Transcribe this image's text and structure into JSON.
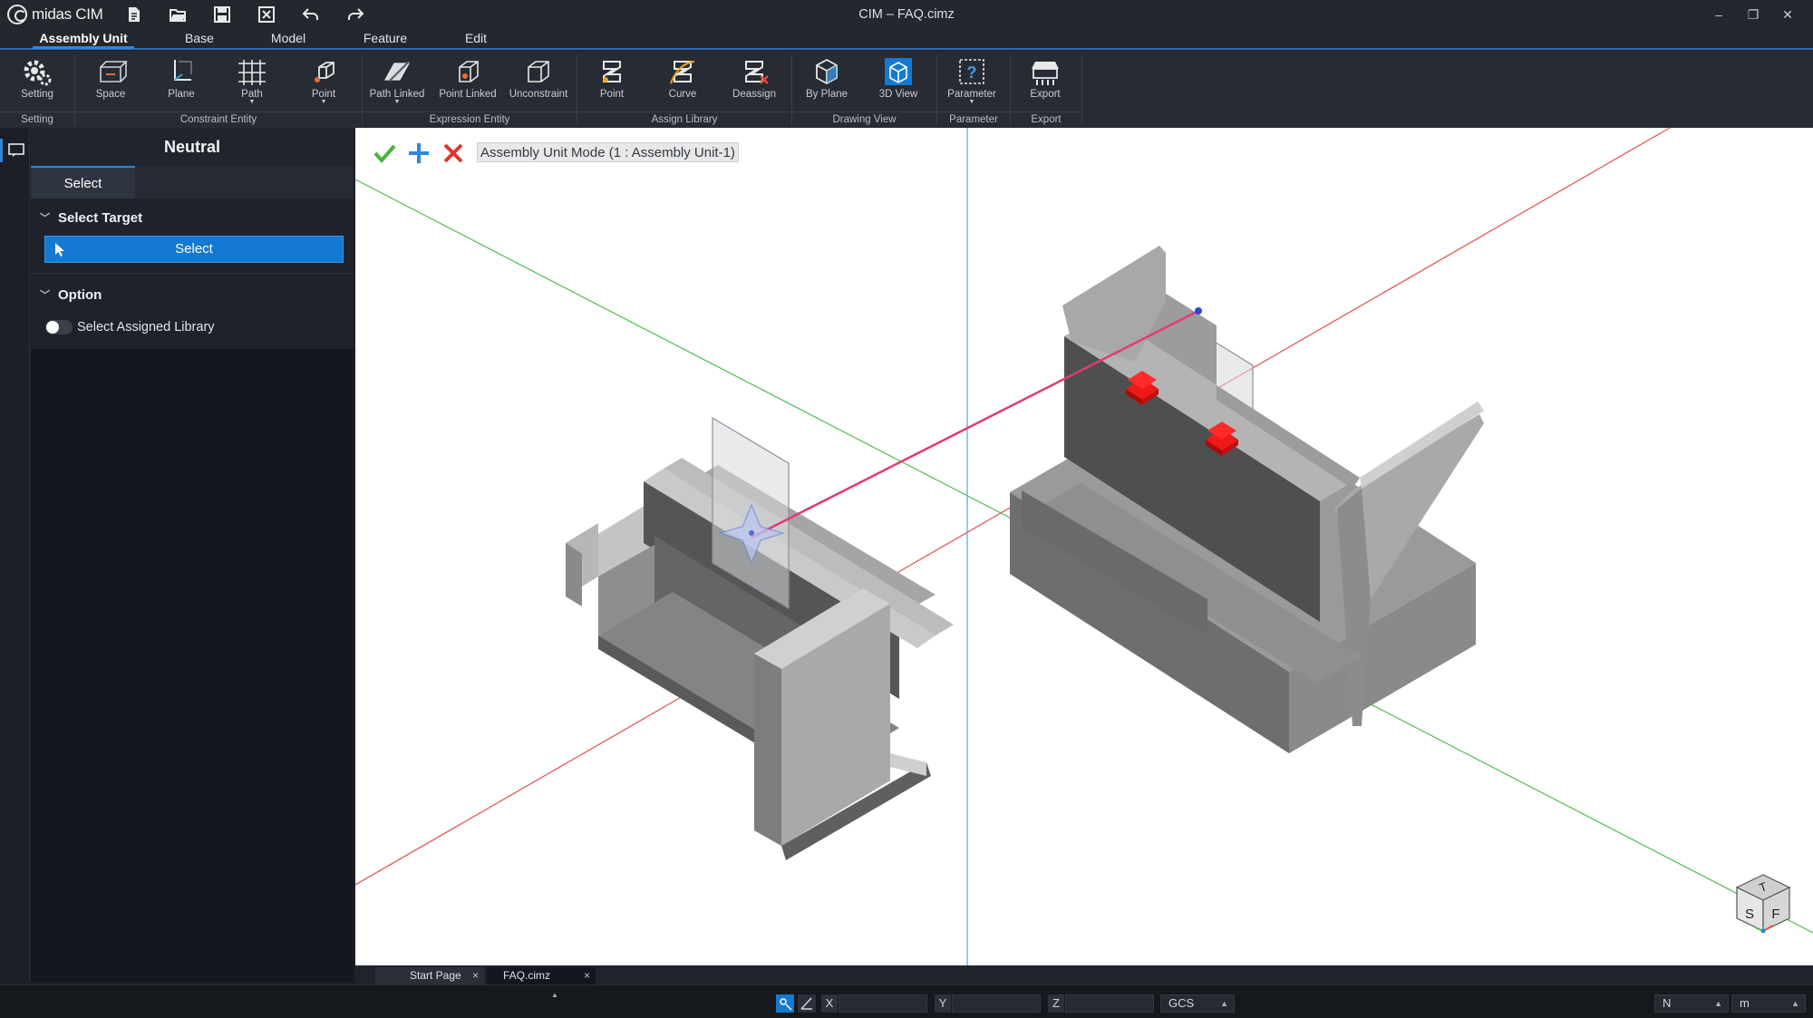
{
  "app": {
    "name": "midas CIM",
    "document_title": "CIM – FAQ.cimz",
    "quick_access": [
      "new-file-icon",
      "open-folder-icon",
      "save-icon",
      "close-file-icon",
      "undo-icon",
      "redo-icon"
    ]
  },
  "menu": {
    "tabs": [
      "Assembly Unit",
      "Base",
      "Model",
      "Feature",
      "Edit"
    ],
    "active": "Assembly Unit"
  },
  "ribbon": {
    "buttons": {
      "setting": "Setting",
      "space": "Space",
      "plane": "Plane",
      "path": "Path",
      "point": "Point",
      "path_linked": "Path Linked",
      "point_linked": "Point Linked",
      "unconstraint": "Unconstraint",
      "lib_point": "Point",
      "curve": "Curve",
      "deassign": "Deassign",
      "by_plane": "By Plane",
      "view_3d": "3D View",
      "parameter": "Parameter",
      "export": "Export"
    },
    "groups": {
      "setting": "Setting",
      "constraint_entity": "Constraint Entity",
      "expression_entity": "Expression Entity",
      "assign_library": "Assign Library",
      "drawing_view": "Drawing View",
      "parameter": "Parameter",
      "export": "Export"
    }
  },
  "panel": {
    "title": "Neutral",
    "tab": "Select",
    "select_target": "Select Target",
    "select_button": "Select",
    "option": "Option",
    "toggle_label": "Select Assigned Library",
    "toggle_on": false
  },
  "viewport": {
    "mode_label": "Assembly Unit Mode (1 : Assembly Unit-1)",
    "navcube_faces": [
      "T",
      "S",
      "F"
    ],
    "axis_colors": {
      "x": "#e05050",
      "y": "#4cc04c",
      "z": "#4aa8e8"
    }
  },
  "doc_tabs": [
    {
      "label": "Start Page",
      "close": "×"
    },
    {
      "label": "FAQ.cimz",
      "close": "×"
    }
  ],
  "status": {
    "coord_labels": [
      "X",
      "Y",
      "Z"
    ],
    "coord_system": "GCS",
    "force_unit": "N",
    "length_unit": "m"
  }
}
